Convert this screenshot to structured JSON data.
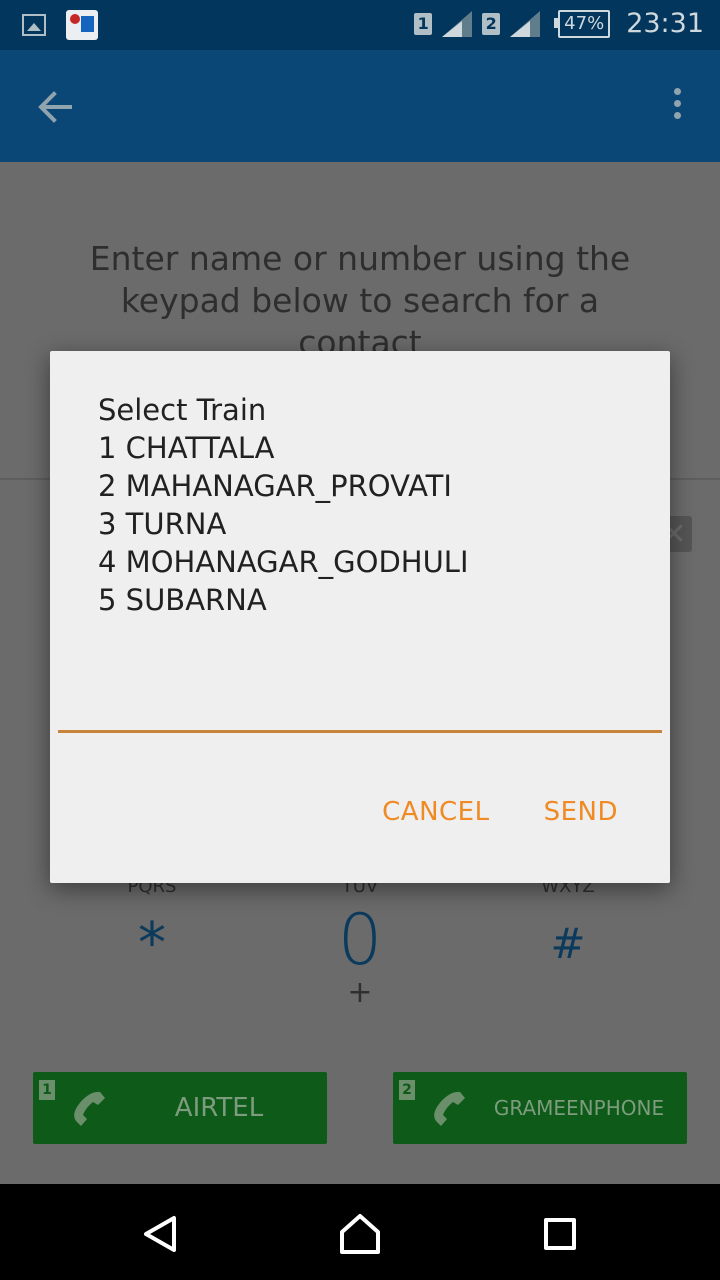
{
  "status_bar": {
    "sim1": "1",
    "sim2": "2",
    "battery": "47%",
    "time": "23:31"
  },
  "dialer": {
    "hint": "Enter name or number using the keypad below to search for a contact",
    "keys": [
      {
        "letters": "PQRS",
        "symbol": "*"
      },
      {
        "letters": "TUV",
        "symbol": "0",
        "sub": "+"
      },
      {
        "letters": "WXYZ",
        "symbol": "#"
      }
    ],
    "call_buttons": [
      {
        "sim": "1",
        "label": "AIRTEL"
      },
      {
        "sim": "2",
        "label": "GRAMEENPHONE"
      }
    ]
  },
  "dialog": {
    "lines": [
      "Select Train",
      "1 CHATTALA",
      "2 MAHANAGAR_PROVATI",
      "3 TURNA",
      "4 MOHANAGAR_GODHULI",
      "5 SUBARNA"
    ],
    "input_value": "",
    "cancel_label": "CANCEL",
    "send_label": "SEND"
  },
  "colors": {
    "appbar": "#0a4777",
    "statusbar": "#03365c",
    "accent": "#f08a24",
    "call_button": "#0d5a19"
  }
}
